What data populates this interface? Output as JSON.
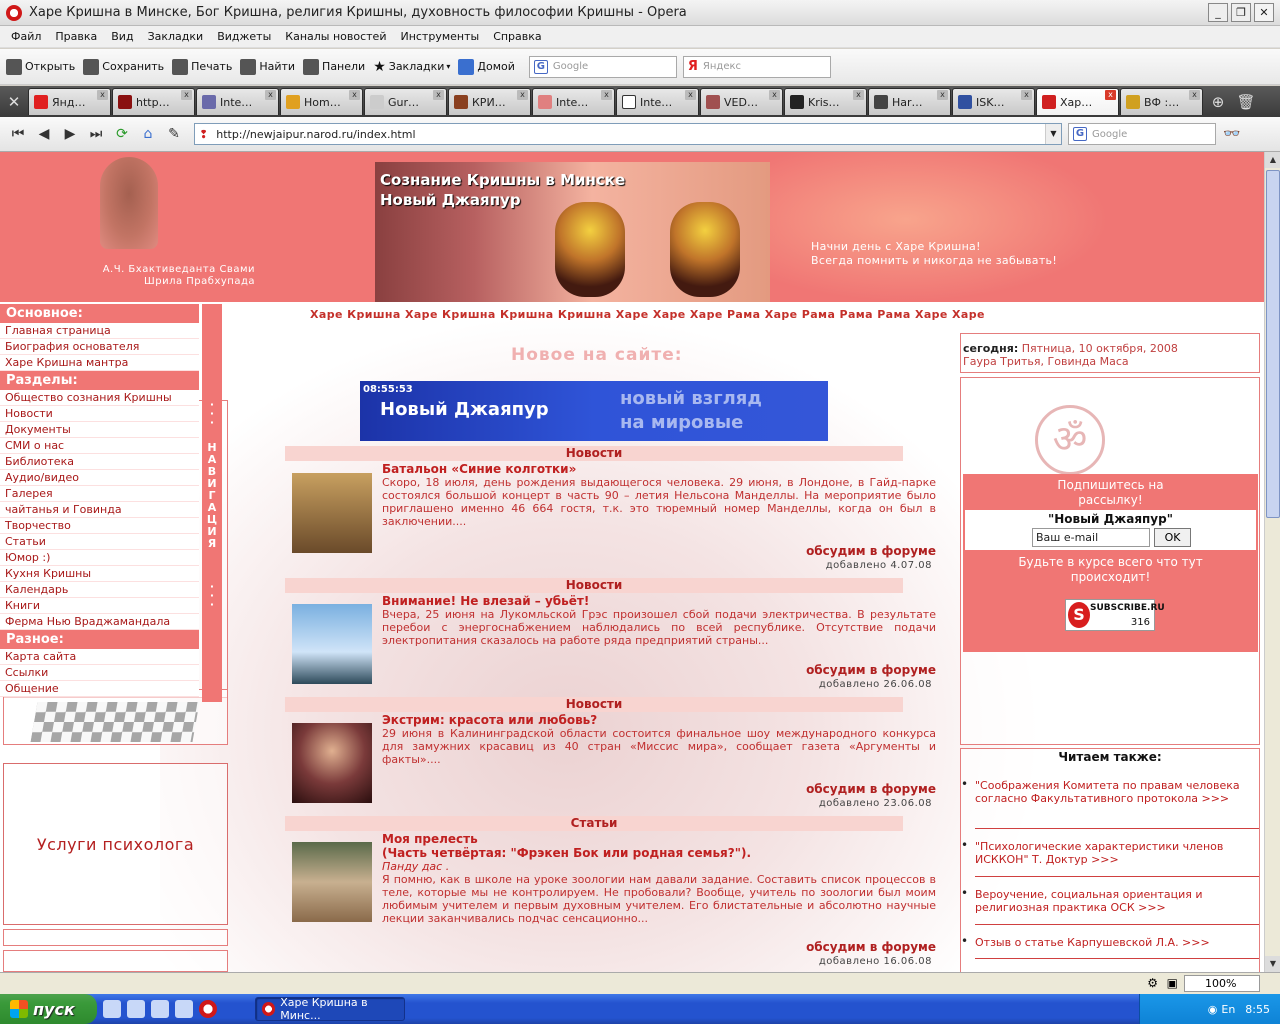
{
  "window": {
    "title": "Харе Кришна в Минске, Бог Кришна, религия Кришны, духовность философии Кришны - Opera"
  },
  "menu": [
    "Файл",
    "Правка",
    "Вид",
    "Закладки",
    "Виджеты",
    "Каналы новостей",
    "Инструменты",
    "Справка"
  ],
  "toolbar": {
    "buttons": [
      "Открыть",
      "Сохранить",
      "Печать",
      "Найти",
      "Панели",
      "Закладки",
      "Домой"
    ],
    "search_google": "Google",
    "search_yandex": "Яндекс"
  },
  "tabs": [
    "Янд…",
    "http…",
    "Inte…",
    "Hom…",
    "Gur…",
    "КРИ…",
    "Inte…",
    "Inte…",
    "VED…",
    "Kris…",
    "Har…",
    "ISK…",
    "Хар…",
    "ВФ :…"
  ],
  "address": {
    "url": "http://newjaipur.narod.ru/index.html",
    "search": "Google"
  },
  "header": {
    "portrait_caption": [
      "А.Ч. Бхактиведанта Свами",
      "Шрила Прабхупада"
    ],
    "banner_title": [
      "Сознание Кришны в Минске",
      "Новый Джаяпур"
    ],
    "slogan": [
      "Начни день с Харе Кришна!",
      "Всегда помнить и никогда не забывать!"
    ]
  },
  "marquee": "Харе Кришна Харе Кришна Кришна Кришна Харе Харе Харе Рама Харе Рама Рама Рама Харе Харе",
  "sidebar": {
    "main_title": "Основное:",
    "main_items": [
      "Главная страница",
      "Биография основателя",
      "Харе Кришна мантра"
    ],
    "sections_title": "Разделы:",
    "section_items": [
      "Общество сознания Кришны",
      "Новости",
      "Документы",
      "СМИ о нас",
      "Библиотека",
      "Аудио/видео",
      "Галерея",
      "чайтанья и Говинда",
      "Творчество",
      "Статьи",
      "Юмор :)",
      "Кухня Кришны",
      "Календарь",
      "Книги",
      "Ферма Нью Враджамандала"
    ],
    "misc_title": "Разное:",
    "misc_items": [
      "Карта сайта",
      "Ссылки",
      "Общение"
    ],
    "nav_word": "НАВИГАЦИЯ"
  },
  "psych_ad": "Услуги психолога",
  "main": {
    "new_title": "Новое на сайте:",
    "news_banner": {
      "clock": "08:55:53",
      "title": "Новый Джаяпур",
      "line1": "новый взгляд",
      "line2": "на мировые новости"
    },
    "articles": [
      {
        "section": "Новости",
        "title": "Батальон «Синие колготки»",
        "subtitle": "",
        "author": "",
        "text": "Скоро, 18 июля, день рождения выдающегося человека. 29 июня, в Лондоне, в Гайд-парке состоялся большой концерт в часть 90 – летия Нельсона Манделлы. На мероприятие было приглашено именно 46 664 гостя, т.к. это тюремный номер Манделлы, когда он был в заключении....",
        "forum": "обсудим в форуме",
        "added": "добавлено 4.07.08"
      },
      {
        "section": "Новости",
        "title": "Внимание! Не влезай – убьёт!",
        "subtitle": "",
        "author": "",
        "text": "Вчера, 25 июня на Лукомльской Грэс произошел сбой подачи электричества. В результате перебои с энергоснабжением наблюдались по всей республике. Отсутствие подачи электропитания сказалось на работе ряда предприятий страны...",
        "forum": "обсудим в форуме",
        "added": "добавлено 26.06.08"
      },
      {
        "section": "Новости",
        "title": "Экстрим: красота или любовь?",
        "subtitle": "",
        "author": "",
        "text": "29 июня в Калининградской области состоится финальное шоу международного конкурса для замужних красавиц из 40 стран «Миссис мира», сообщает газета «Аргументы и факты»....",
        "forum": "обсудим в форуме",
        "added": "добавлено 23.06.08"
      },
      {
        "section": "Статьи",
        "title": "Моя прелесть",
        "subtitle": "(Часть четвёртая: \"Фрэкен Бок или родная семья?\").",
        "author": "Панду дас .",
        "text": "Я помню, как в школе на уроке зоологии нам давали задание. Составить список процессов в теле, которые мы не контролируем. Не пробовали? Вообще, учитель по зоологии был моим любимым учителем и первым духовным учителем. Его блистательные и  абсолютно научные лекции заканчивались подчас сенсационно...",
        "forum": "обсудим в форуме",
        "added": "добавлено 16.06.08"
      }
    ]
  },
  "right": {
    "date_label": "сегодня:",
    "date_value": "Пятница, 10 октября, 2008",
    "vaishnava_date": "Гаура Тритья, Говинда Маса",
    "subscribe": {
      "head": [
        "Подпишитесь на",
        "рассылку!"
      ],
      "name": "\"Новый Джаяпур\"",
      "email_value": "Ваш e-mail",
      "ok": "OK",
      "foot": [
        "Будьте в курсе всего что тут",
        "происходит!"
      ],
      "badge_name": "SUBSCRIBE.RU",
      "badge_count": "316"
    },
    "also_title": "Читаем также:",
    "also_items": [
      "\"Соображения Комитета по правам человека согласно Факультативного протокола >>>",
      "\"Психологические характеристики членов ИСККОН\" Т. Доктур >>>",
      "Вероучение, социальная ориентация и религиозная практика ОСК >>>",
      "Отзыв о статье Карпушевской Л.А. >>>"
    ]
  },
  "status": {
    "zoom": "100%"
  },
  "taskbar": {
    "start": "пуск",
    "task": "Харе Кришна в Минс...",
    "lang": "EN",
    "lang2": "En",
    "clock": "8:55"
  }
}
